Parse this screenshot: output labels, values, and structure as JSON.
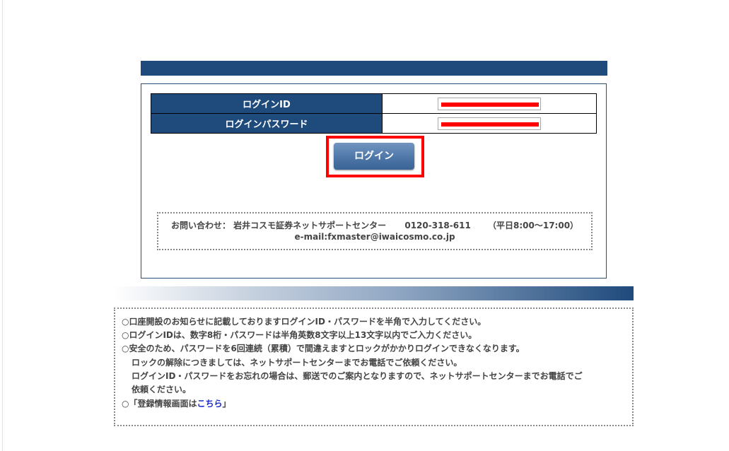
{
  "login": {
    "id_label": "ログインID",
    "password_label": "ログインパスワード",
    "button_label": "ログイン"
  },
  "contact": {
    "prefix": "お問い合わせ：",
    "center": "岩井コスモ証券ネットサポートセンター",
    "phone": "0120-318-611",
    "hours": "（平日8:00～17:00）",
    "email": "e-mail:fxmaster@iwaicosmo.co.jp"
  },
  "notes": {
    "line1": "○口座開設のお知らせに記載しておりますログインID・パスワードを半角で入力してください。",
    "line2": "○ログインIDは、数字8桁・パスワードは半角英数8文字以上13文字以内でご入力ください。",
    "line3": "○安全のため、パスワードを6回連続（累積）で間違えますとロックがかかりログインできなくなります。",
    "line4": "ロックの解除につきましては、ネットサポートセンターまでお電話でご依頼ください。",
    "line5": "ログインID・パスワードをお忘れの場合は、郵送でのご案内となりますので、ネットサポートセンターまでお電話でご",
    "line6": "依頼ください。",
    "line7_prefix": "○「登録情報画面は",
    "line7_link": "こちら",
    "line7_suffix": "」"
  },
  "colors": {
    "header_blue": "#1f4a7c",
    "highlight_red": "#ff0000",
    "link_blue": "#1a2ccf"
  }
}
